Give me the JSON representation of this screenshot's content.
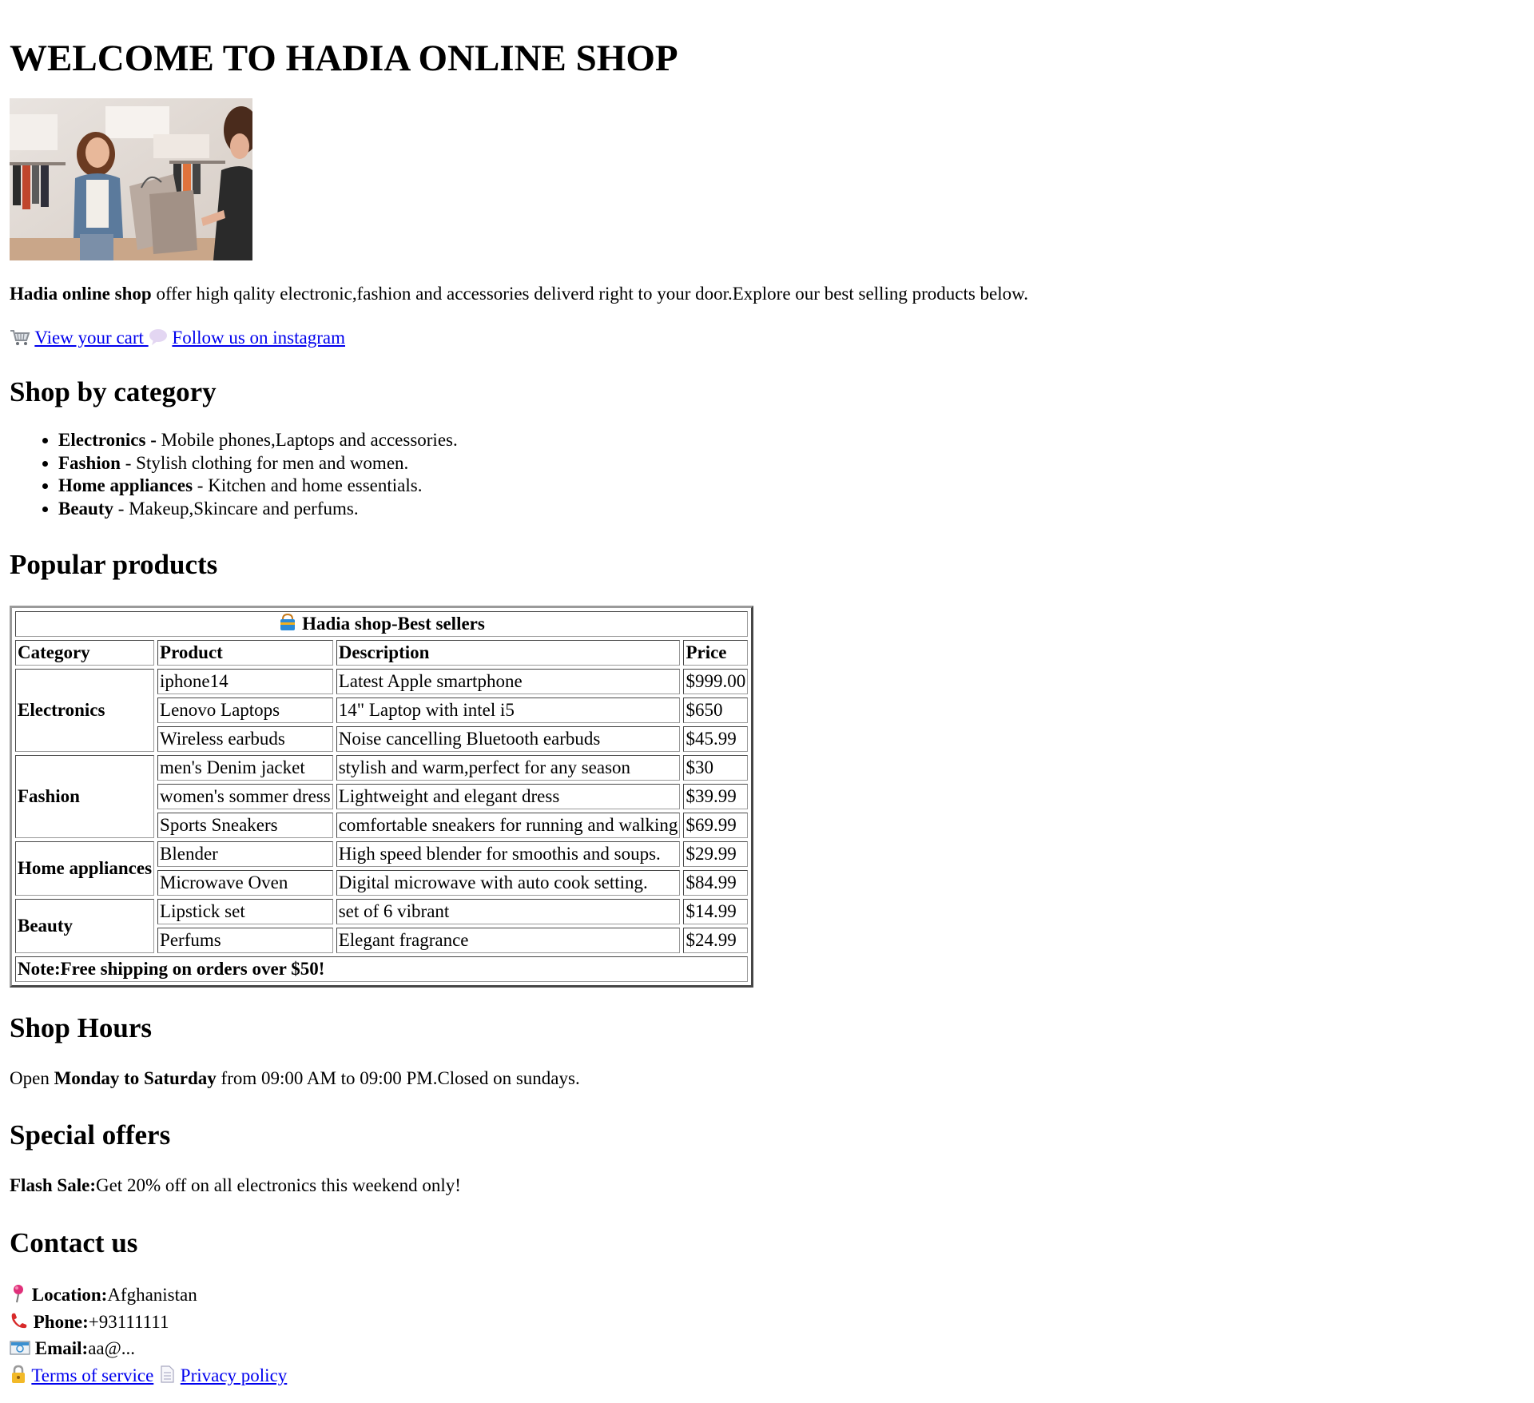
{
  "header": {
    "title": "WELCOME TO HADIA ONLINE SHOP"
  },
  "hero_image": {
    "icon": "shopping-photo"
  },
  "intro": {
    "shop_name": "Hadia online shop",
    "text": " offer high qality electronic,fashion and accessories deliverd right to your door.Explore our best selling products below."
  },
  "links": {
    "cart_icon": "shopping-cart-icon",
    "cart_label": "View your cart ",
    "instagram_icon": "speech-bubble-icon",
    "instagram_label": "Follow us on instagram"
  },
  "categories": {
    "heading": "Shop by category",
    "items": [
      {
        "name": "Electronics",
        "sep": " - ",
        "desc": "Mobile phones,Laptops and accessories."
      },
      {
        "name": "Fashion",
        "sep": " - ",
        "desc": "Stylish clothing for men and women."
      },
      {
        "name": "Home appliances",
        "sep": " - ",
        "desc": "Kitchen and home essentials."
      },
      {
        "name": "Beauty",
        "sep": " - ",
        "desc": "Makeup,Skincare and perfums."
      }
    ]
  },
  "products": {
    "heading": "Popular products",
    "caption_icon": "shopping-bag-icon",
    "caption": "Hadia shop-Best sellers",
    "columns": [
      "Category",
      "Product",
      "Description",
      "Price"
    ],
    "groups": [
      {
        "category": "Electronics",
        "rows": [
          {
            "product": "iphone14",
            "description": "Latest Apple smartphone",
            "price": "$999.00"
          },
          {
            "product": "Lenovo Laptops",
            "description": "14\" Laptop with intel i5",
            "price": "$650"
          },
          {
            "product": "Wireless earbuds",
            "description": "Noise cancelling Bluetooth earbuds",
            "price": "$45.99"
          }
        ]
      },
      {
        "category": "Fashion",
        "rows": [
          {
            "product": "men's Denim jacket",
            "description": "stylish and warm,perfect for any season",
            "price": "$30"
          },
          {
            "product": "women's sommer dress",
            "description": "Lightweight and elegant dress",
            "price": "$39.99"
          },
          {
            "product": "Sports Sneakers",
            "description": "comfortable sneakers for running and walking",
            "price": "$69.99"
          }
        ]
      },
      {
        "category": "Home appliances",
        "rows": [
          {
            "product": "Blender",
            "description": "High speed blender for smoothis and soups.",
            "price": "$29.99"
          },
          {
            "product": "Microwave Oven",
            "description": "Digital microwave with auto cook setting.",
            "price": "$84.99"
          }
        ]
      },
      {
        "category": "Beauty",
        "rows": [
          {
            "product": "Lipstick set",
            "description": "set of 6 vibrant",
            "price": "$14.99"
          },
          {
            "product": "Perfums",
            "description": "Elegant fragrance",
            "price": "$24.99"
          }
        ]
      }
    ],
    "note": "Note:Free shipping on orders over $50!"
  },
  "hours": {
    "heading": "Shop Hours",
    "prefix": "Open ",
    "days": "Monday to Saturday",
    "suffix": " from 09:00 AM to 09:00 PM.Closed on sundays."
  },
  "offers": {
    "heading": "Special offers",
    "label": "Flash Sale:",
    "text": "Get 20% off on all electronics this weekend only!"
  },
  "contact": {
    "heading": "Contact us",
    "location_icon": "pushpin-icon",
    "location_label": "Location:",
    "location_value": "Afghanistan",
    "phone_icon": "telephone-icon",
    "phone_label": "Phone:",
    "phone_value": "+93111111",
    "email_icon": "envelope-icon",
    "email_label": "Email:",
    "email_value": "aa@...",
    "terms_icon": "lock-icon",
    "terms_label": "Terms of service",
    "privacy_icon": "document-icon",
    "privacy_label": "Privacy policy"
  },
  "colors": {
    "link": "#0000ee",
    "text": "#000000",
    "background": "#ffffff"
  }
}
